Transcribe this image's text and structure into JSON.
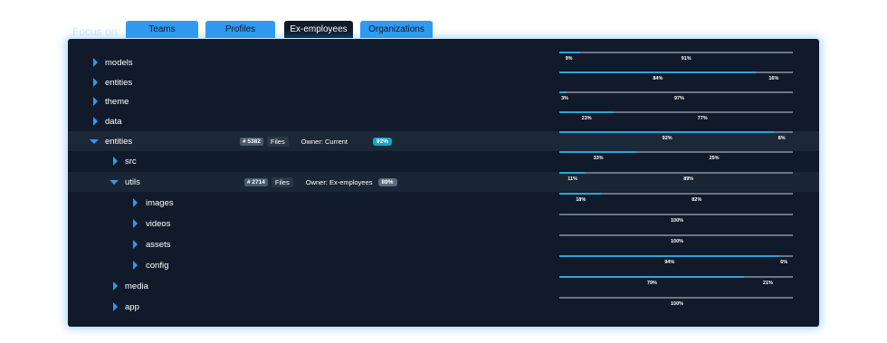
{
  "focus_label": "Focus on",
  "tabs": [
    {
      "label": "Teams",
      "active": false
    },
    {
      "label": "Profiles",
      "active": false
    },
    {
      "label": "Ex-employees",
      "active": true
    },
    {
      "label": "Organizations",
      "active": false
    }
  ],
  "colors": {
    "accent_blue": "#2f9af0",
    "panel_bg": "#101a2a",
    "bar_fill": "#2aa6d8",
    "bar_track": "#6b7685",
    "percent_badge_teal": "#12a7c8",
    "percent_badge_gray": "#5d6a7b"
  },
  "tree": [
    {
      "label": "models",
      "expanded": false
    },
    {
      "label": "entities",
      "expanded": false
    },
    {
      "label": "theme",
      "expanded": false
    },
    {
      "label": "data",
      "expanded": false
    },
    {
      "label": "entities",
      "expanded": true,
      "selected": true,
      "count": "# 5382",
      "files": "Files",
      "owner": "Owner:  Current",
      "percent": "92%",
      "percent_badge": "teal"
    },
    {
      "label": "src",
      "expanded": false
    },
    {
      "label": "utils",
      "expanded": true,
      "count": "# 2714",
      "files": "Files",
      "owner": "Owner:  Ex-employees",
      "percent": "89%",
      "percent_badge": "gray"
    },
    {
      "label": "images",
      "expanded": false
    },
    {
      "label": "videos",
      "expanded": false
    },
    {
      "label": "assets",
      "expanded": false
    },
    {
      "label": "config",
      "expanded": false
    },
    {
      "label": "media",
      "expanded": false
    },
    {
      "label": "app",
      "expanded": false
    }
  ],
  "bars": [
    {
      "fill": 0.09,
      "left_label": "9%",
      "right_label": "91%"
    },
    {
      "fill": 0.84,
      "left_label": "84%",
      "right_label": "16%"
    },
    {
      "fill": 0.03,
      "left_label": "3%",
      "right_label": "97%"
    },
    {
      "fill": 0.23,
      "left_label": "23%",
      "right_label": "77%"
    },
    {
      "fill": 0.92,
      "left_label": "92%",
      "right_label": "8%"
    },
    {
      "fill": 0.33,
      "left_label": "33%",
      "right_label": "25%"
    },
    {
      "fill": 0.11,
      "left_label": "11%",
      "right_label": "89%"
    },
    {
      "fill": 0.18,
      "left_label": "18%",
      "right_label": "82%"
    },
    {
      "fill": 0.0,
      "left_label": "",
      "right_label": "100%"
    },
    {
      "fill": 0.0,
      "left_label": "",
      "right_label": "100%"
    },
    {
      "fill": 0.94,
      "left_label": "94%",
      "right_label": "6%"
    },
    {
      "fill": 0.79,
      "left_label": "79%",
      "right_label": "21%"
    },
    {
      "fill": 0.0,
      "left_label": "",
      "right_label": "100%"
    }
  ]
}
